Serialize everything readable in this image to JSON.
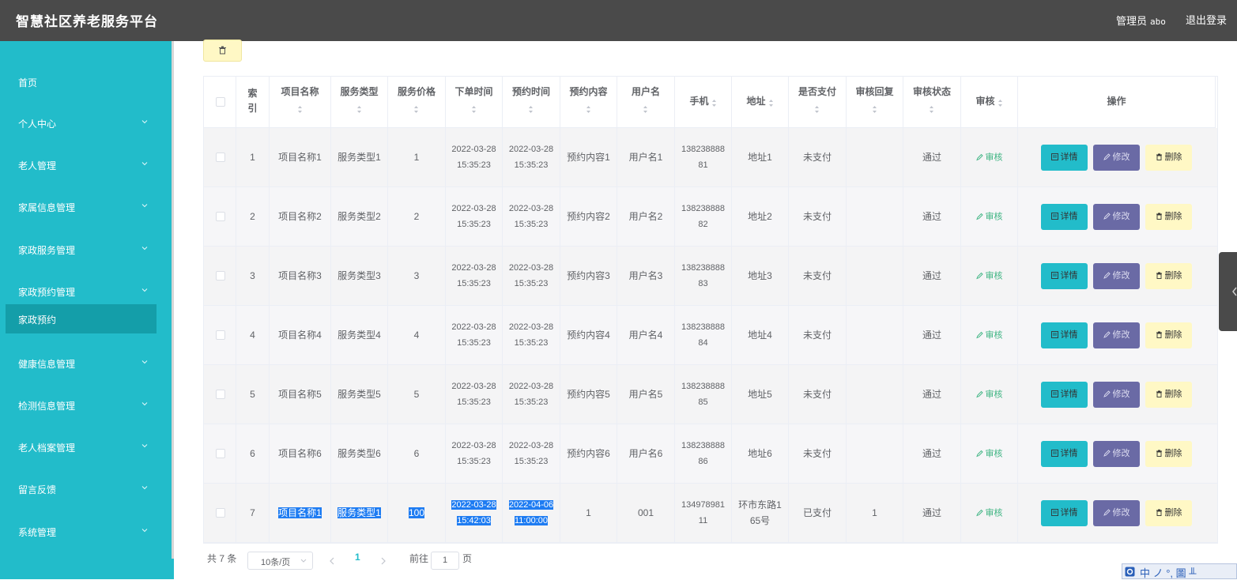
{
  "header": {
    "title": "智慧社区养老服务平台",
    "user_label": "管理员",
    "username": "abo",
    "logout": "退出登录"
  },
  "sidebar": {
    "items": [
      {
        "label": "首页",
        "has_chevron": false
      },
      {
        "label": "个人中心",
        "has_chevron": true
      },
      {
        "label": "老人管理",
        "has_chevron": true
      },
      {
        "label": "家属信息管理",
        "has_chevron": true
      },
      {
        "label": "家政服务管理",
        "has_chevron": true
      },
      {
        "label": "家政预约管理",
        "has_chevron": true
      },
      {
        "label": "家政预约",
        "has_chevron": false,
        "active": true
      },
      {
        "label": "健康信息管理",
        "has_chevron": true
      },
      {
        "label": "检测信息管理",
        "has_chevron": true
      },
      {
        "label": "老人档案管理",
        "has_chevron": true
      },
      {
        "label": "留言反馈",
        "has_chevron": true
      },
      {
        "label": "系统管理",
        "has_chevron": true
      }
    ]
  },
  "toolbar": {
    "delete_icon": "trash-icon"
  },
  "table": {
    "columns": [
      {
        "label": "索引",
        "sortable": false
      },
      {
        "label": "项目名称",
        "sortable": true
      },
      {
        "label": "服务类型",
        "sortable": true
      },
      {
        "label": "服务价格",
        "sortable": true
      },
      {
        "label": "下单时间",
        "sortable": true
      },
      {
        "label": "预约时间",
        "sortable": true
      },
      {
        "label": "预约内容",
        "sortable": true
      },
      {
        "label": "用户名",
        "sortable": true
      },
      {
        "label": "手机",
        "sortable": true
      },
      {
        "label": "地址",
        "sortable": true
      },
      {
        "label": "是否支付",
        "sortable": true
      },
      {
        "label": "审核回复",
        "sortable": true
      },
      {
        "label": "审核状态",
        "sortable": true
      },
      {
        "label": "审核",
        "sortable": true
      },
      {
        "label": "操作",
        "sortable": false
      }
    ],
    "rows": [
      {
        "index": "1",
        "name": "项目名称1",
        "type": "服务类型1",
        "price": "1",
        "order_time": "2022-03-28 15:35:23",
        "appt_time": "2022-03-28 15:35:23",
        "content": "预约内容1",
        "user": "用户名1",
        "phone": "13823888881",
        "addr": "地址1",
        "paid": "未支付",
        "reply": "",
        "status": "通过"
      },
      {
        "index": "2",
        "name": "项目名称2",
        "type": "服务类型2",
        "price": "2",
        "order_time": "2022-03-28 15:35:23",
        "appt_time": "2022-03-28 15:35:23",
        "content": "预约内容2",
        "user": "用户名2",
        "phone": "13823888882",
        "addr": "地址2",
        "paid": "未支付",
        "reply": "",
        "status": "通过"
      },
      {
        "index": "3",
        "name": "项目名称3",
        "type": "服务类型3",
        "price": "3",
        "order_time": "2022-03-28 15:35:23",
        "appt_time": "2022-03-28 15:35:23",
        "content": "预约内容3",
        "user": "用户名3",
        "phone": "13823888883",
        "addr": "地址3",
        "paid": "未支付",
        "reply": "",
        "status": "通过"
      },
      {
        "index": "4",
        "name": "项目名称4",
        "type": "服务类型4",
        "price": "4",
        "order_time": "2022-03-28 15:35:23",
        "appt_time": "2022-03-28 15:35:23",
        "content": "预约内容4",
        "user": "用户名4",
        "phone": "13823888884",
        "addr": "地址4",
        "paid": "未支付",
        "reply": "",
        "status": "通过"
      },
      {
        "index": "5",
        "name": "项目名称5",
        "type": "服务类型5",
        "price": "5",
        "order_time": "2022-03-28 15:35:23",
        "appt_time": "2022-03-28 15:35:23",
        "content": "预约内容5",
        "user": "用户名5",
        "phone": "13823888885",
        "addr": "地址5",
        "paid": "未支付",
        "reply": "",
        "status": "通过"
      },
      {
        "index": "6",
        "name": "项目名称6",
        "type": "服务类型6",
        "price": "6",
        "order_time": "2022-03-28 15:35:23",
        "appt_time": "2022-03-28 15:35:23",
        "content": "预约内容6",
        "user": "用户名6",
        "phone": "13823888886",
        "addr": "地址6",
        "paid": "未支付",
        "reply": "",
        "status": "通过"
      },
      {
        "index": "7",
        "name": "项目名称1",
        "type": "服务类型1",
        "price": "100",
        "order_time": "2022-03-28 15:42:03",
        "appt_time": "2022-04-06 11:00:00",
        "content": "1",
        "user": "001",
        "phone": "13497898111",
        "addr": "环市东路165号",
        "paid": "已支付",
        "reply": "1",
        "status": "通过",
        "selected": true
      }
    ],
    "actions": {
      "audit": "审核",
      "detail": "详情",
      "edit": "修改",
      "delete": "删除"
    }
  },
  "pagination": {
    "total_prefix": "共",
    "total": "7",
    "total_suffix": "条",
    "page_size": "10条/页",
    "current_page": "1",
    "goto_label": "前往",
    "goto_value": "1",
    "page_suffix": "页"
  },
  "colors": {
    "header": "#4a4a4a",
    "sidebar": "#22bcca",
    "sidebar_active": "#149ea9",
    "detail_btn": "#22bcca",
    "edit_btn": "#6a6aa5",
    "delete_btn": "#fff8c5",
    "audit_link": "#3bb380",
    "selection": "#1e7cf2"
  }
}
